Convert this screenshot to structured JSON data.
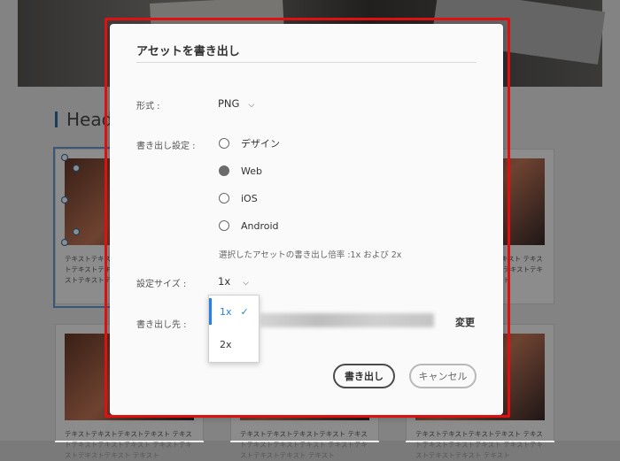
{
  "dialog": {
    "title": "アセットを書き出し",
    "format_label": "形式 :",
    "format_value": "PNG",
    "export_settings_label": "書き出し設定 :",
    "options": [
      {
        "label": "デザイン",
        "selected": false
      },
      {
        "label": "Web",
        "selected": true
      },
      {
        "label": "iOS",
        "selected": false
      },
      {
        "label": "Android",
        "selected": false
      }
    ],
    "scale_note": "選択したアセットの書き出し倍率 :1x および 2x",
    "size_label": "設定サイズ :",
    "size_value": "1x",
    "size_options": [
      "1x",
      "2x"
    ],
    "size_selected": "1x",
    "destination_label": "書き出し先 :",
    "change_label": "変更",
    "export_button": "書き出し",
    "cancel_button": "キャンセル"
  },
  "background": {
    "heading": "Headline",
    "card_text": "テキストテキストテキストテキスト テキストテキストテキストテキスト テキストテキストテキストテキスト テキスト"
  },
  "colors": {
    "accent": "#2680eb",
    "highlight_frame": "#e01010",
    "overlay": "rgba(0,0,0,0.45)"
  }
}
